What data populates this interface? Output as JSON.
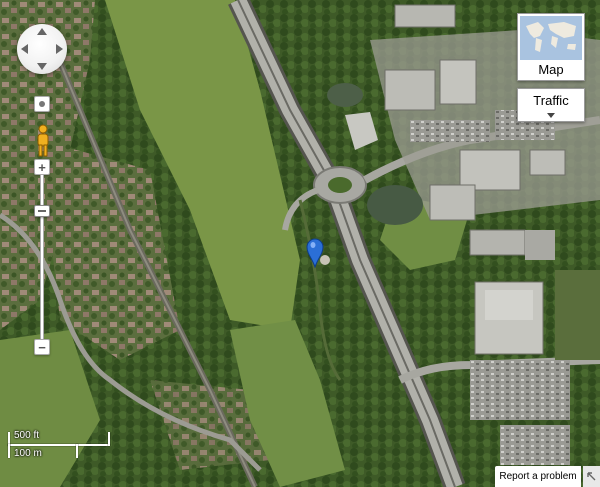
{
  "map_view": {
    "mode": "satellite",
    "controls": {
      "pan_icon": "pan-arrows-icon",
      "zoom_in_icon": "plus-icon",
      "zoom_out_icon": "minus-icon",
      "zoom_in_label": "+",
      "zoom_out_label": "−",
      "street_view_icon": "pegman-icon",
      "zoom_level_fraction": 0.2
    },
    "map_type_button": {
      "label": "Map",
      "icon": "world-map-thumbnail-icon"
    },
    "traffic_button": {
      "label": "Traffic",
      "icon": "chevron-down-icon"
    },
    "scale": {
      "imperial": "500 ft",
      "metric": "100 m"
    },
    "report_link": "Report a problem",
    "marker": {
      "icon": "map-pin-icon",
      "color": "#2b6fd6"
    }
  },
  "colors": {
    "vegetation_dark": "#3f5d27",
    "grass_light": "#7d9a4d",
    "road": "#a9a9a2",
    "building_roof": "#b9b9b4",
    "water": "#4d5e48"
  }
}
